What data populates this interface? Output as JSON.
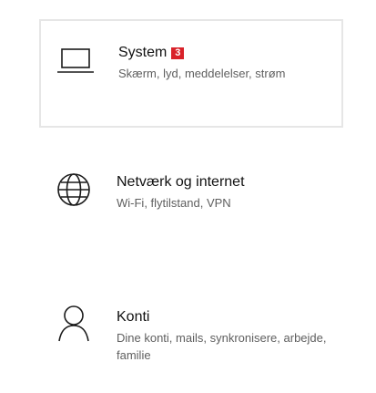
{
  "settings": {
    "items": [
      {
        "title": "System",
        "badge": "3",
        "description": "Skærm, lyd, meddelelser, strøm",
        "icon": "laptop-icon",
        "selected": true
      },
      {
        "title": "Netværk og internet",
        "description": "Wi-Fi, flytilstand, VPN",
        "icon": "globe-icon"
      },
      {
        "title": "Konti",
        "description": "Dine konti, mails, synkronisere, arbejde, familie",
        "icon": "person-icon"
      }
    ]
  },
  "colors": {
    "badge_bg": "#d9222a",
    "tile_border": "#e6e6e6"
  }
}
